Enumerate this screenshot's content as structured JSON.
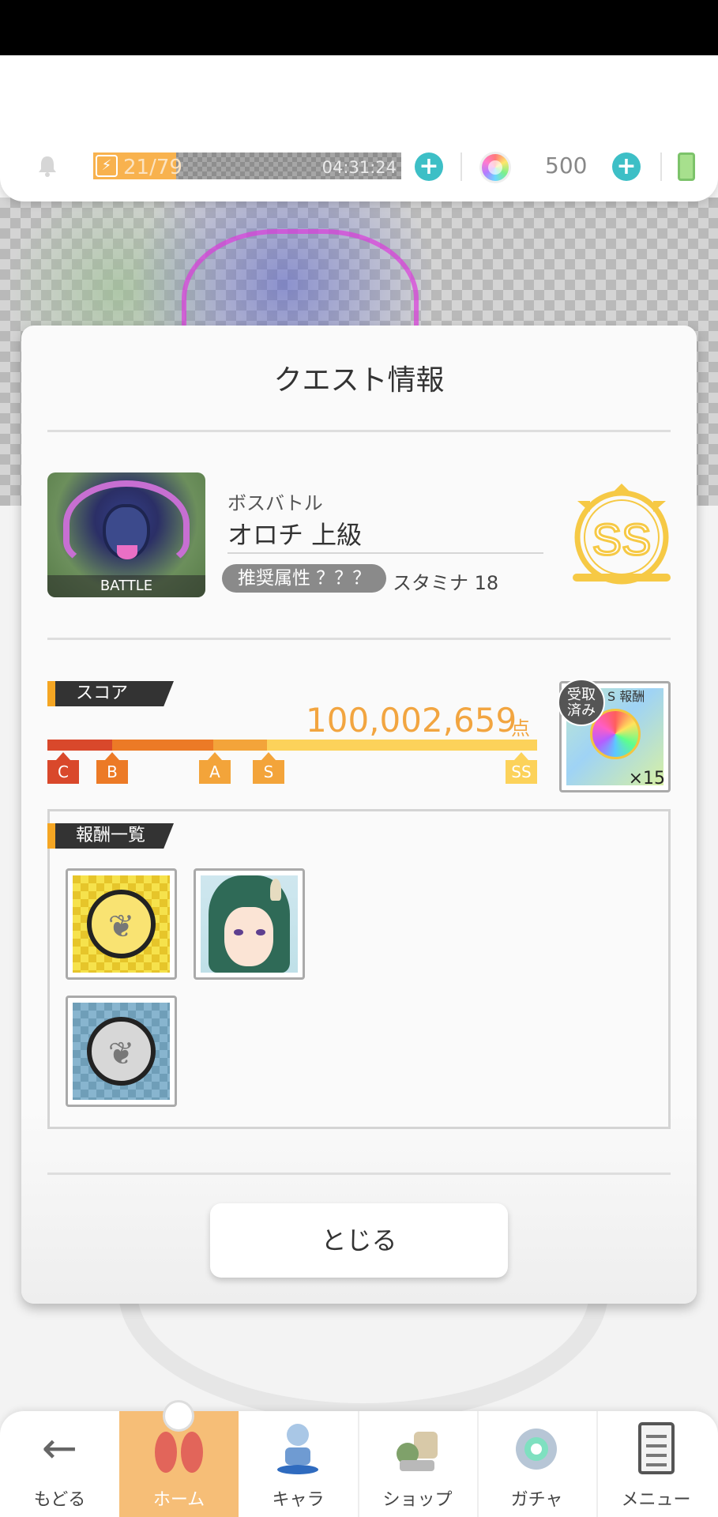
{
  "header": {
    "stamina": "21/79",
    "stamina_fraction": 0.27,
    "timer": "04:31:24",
    "gems": "500"
  },
  "modal": {
    "title": "クエスト情報",
    "quest": {
      "thumb_label": "BATTLE",
      "type": "ボスバトル",
      "name": "オロチ 上級",
      "recommended_attr": "推奨属性 ？？？",
      "stamina_cost": "スタミナ 18",
      "rank": "SS"
    },
    "score": {
      "tag": "スコア",
      "value": "100,002,659",
      "unit": "点",
      "ranks": [
        "C",
        "B",
        "A",
        "S",
        "SS"
      ]
    },
    "ss_reward": {
      "label": "S 報酬",
      "received": "受取\n済み",
      "quantity": "×15"
    },
    "rewards": {
      "tag": "報酬一覧"
    },
    "close_label": "とじる"
  },
  "nav": {
    "items": [
      "もどる",
      "ホーム",
      "キャラ",
      "ショップ",
      "ガチャ",
      "メニュー"
    ],
    "active": "ホーム"
  },
  "colors": {
    "accent_orange": "#f2a540",
    "plus_teal": "#3dbfc6",
    "rank_gold": "#f6c945"
  }
}
